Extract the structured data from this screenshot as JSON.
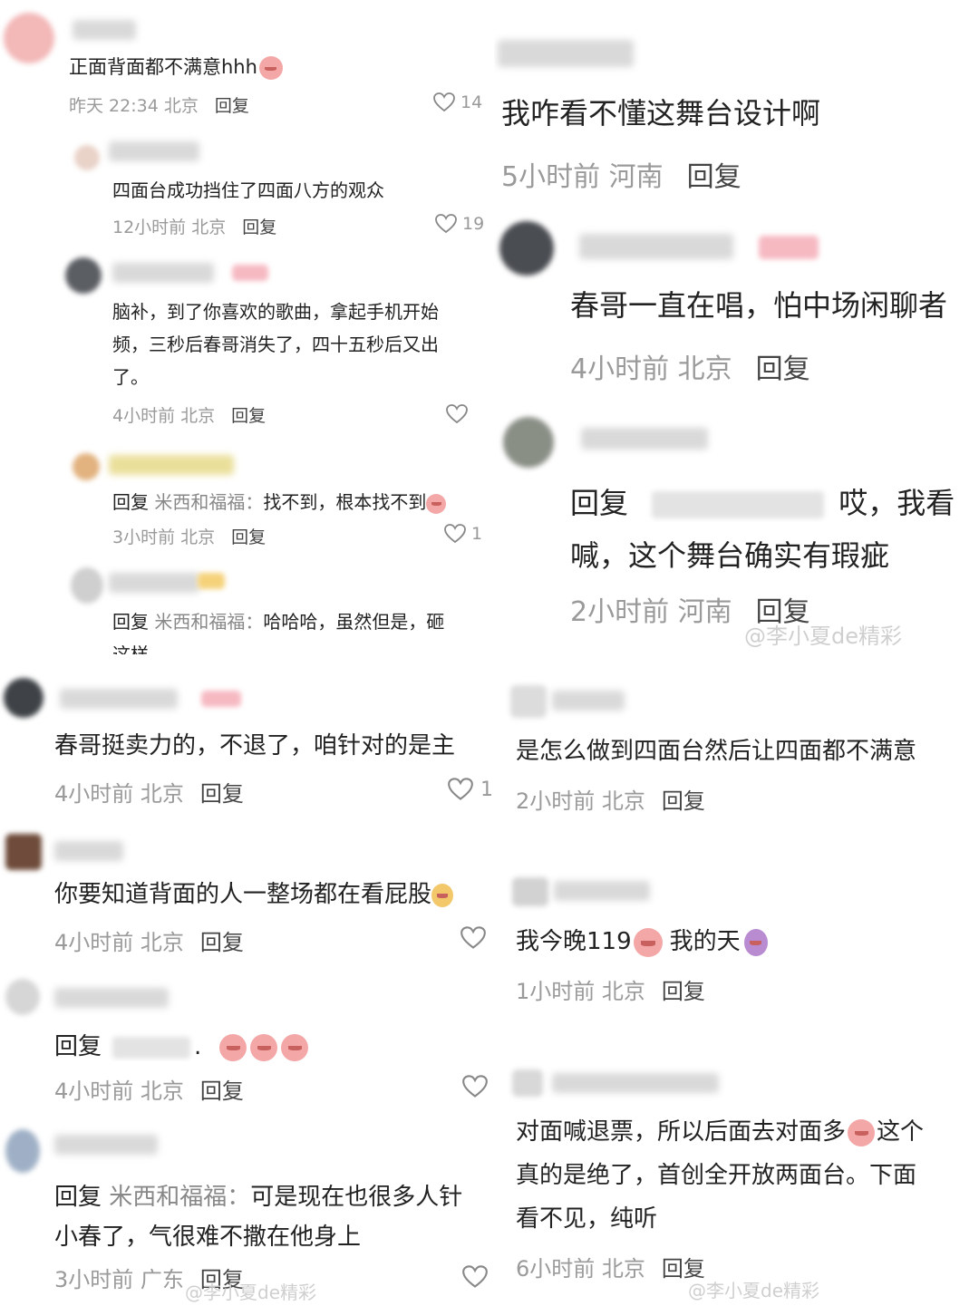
{
  "panel_tl": {
    "c1": {
      "text": "正面背面都不满意hhh",
      "time": "昨天 22:34 北京",
      "reply": "回复",
      "likes": "14"
    },
    "c2": {
      "text": "四面台成功挡住了四面八方的观众",
      "time": "12小时前 北京",
      "reply": "回复",
      "likes": "19"
    },
    "c3": {
      "line1": "脑补，到了你喜欢的歌曲，拿起手机开始",
      "line2": "频，三秒后春哥消失了，四十五秒后又出",
      "line3": "了。",
      "time": "4小时前 北京",
      "reply": "回复"
    },
    "c4": {
      "prefix": "回复",
      "mention": "米西和福福：",
      "text": "找不到，根本找不到",
      "time": "3小时前 北京",
      "reply": "回复",
      "likes": "1"
    },
    "c5": {
      "prefix": "回复",
      "mention": "米西和福福：",
      "text": "哈哈哈，虽然但是，砸",
      "line2": "这样"
    }
  },
  "panel_tr": {
    "c1": {
      "text": "我咋看不懂这舞台设计啊",
      "time": "5小时前 河南",
      "reply": "回复"
    },
    "c2": {
      "text": "春哥一直在唱，怕中场闲聊者",
      "time": "4小时前 北京",
      "reply": "回复"
    },
    "c3": {
      "prefix": "回复",
      "text1": "哎，我看",
      "line2": "喊，这个舞台确实有瑕疵",
      "time": "2小时前 河南",
      "reply": "回复"
    },
    "watermark": "@李小夏de精彩"
  },
  "panel_bl": {
    "c1": {
      "text": "春哥挺卖力的，不退了，咱针对的是主",
      "time": "4小时前 北京",
      "reply": "回复",
      "likes": "1"
    },
    "c2": {
      "text": "你要知道背面的人一整场都在看屁股",
      "time": "4小时前 北京",
      "reply": "回复"
    },
    "c3": {
      "prefix": "回复",
      "dot": ".",
      "time": "4小时前 北京",
      "reply": "回复"
    },
    "c4": {
      "prefix": "回复",
      "mention": "米西和福福：",
      "text": "可是现在也很多人针",
      "line2": "小春了，气很难不撒在他身上",
      "time": "3小时前 广东",
      "reply": "回复"
    },
    "watermark": "@李小夏de精彩"
  },
  "panel_br": {
    "c1": {
      "text": "是怎么做到四面台然后让四面都不满意",
      "time": "2小时前 北京",
      "reply": "回复"
    },
    "c2": {
      "text1": "我今晚119",
      "text2": "我的天",
      "time": "1小时前 北京",
      "reply": "回复"
    },
    "c3": {
      "line1a": "对面喊退票，所以后面去对面多",
      "line1b": "这个",
      "line2": "真的是绝了，首创全开放两面台。下面",
      "line3": "看不见，纯听",
      "time": "6小时前 北京",
      "reply": "回复"
    },
    "watermark": "@李小夏de精彩"
  }
}
